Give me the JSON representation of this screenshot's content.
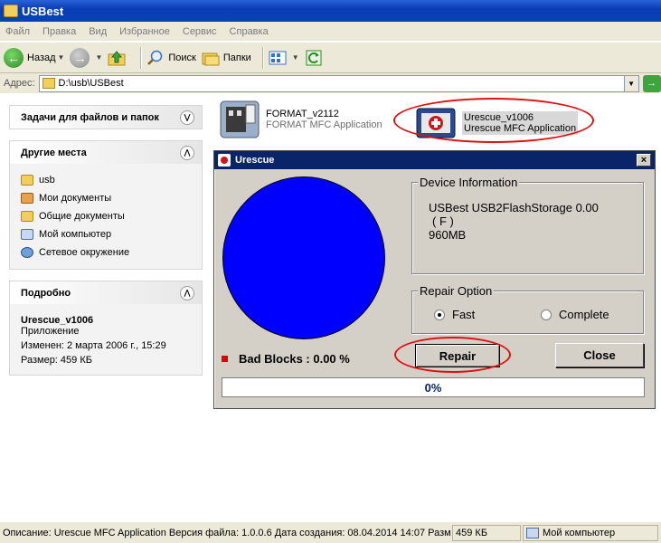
{
  "window": {
    "title": "USBest"
  },
  "menu": [
    "Файл",
    "Правка",
    "Вид",
    "Избранное",
    "Сервис",
    "Справка"
  ],
  "toolbar": {
    "back": "Назад",
    "search": "Поиск",
    "folders": "Папки"
  },
  "address": {
    "label": "Адрес:",
    "value": "D:\\usb\\USBest"
  },
  "left": {
    "tasks_title": "Задачи для файлов и папок",
    "places_title": "Другие места",
    "places": [
      "usb",
      "Мои документы",
      "Общие документы",
      "Мой компьютер",
      "Сетевое окружение"
    ],
    "details_title": "Подробно",
    "details": {
      "name": "Urescue_v1006",
      "type": "Приложение",
      "modified": "Изменен: 2 марта 2006 г., 15:29",
      "size": "Размер: 459 КБ"
    }
  },
  "files": [
    {
      "name": "FORMAT_v2112",
      "desc": "FORMAT MFC Application"
    },
    {
      "name": "Urescue_v1006",
      "desc": "Urescue MFC Application"
    }
  ],
  "dialog": {
    "title": "Urescue",
    "close_x": "×",
    "device_info_title": "Device Information",
    "device_line1": "USBest   USB2FlashStorage 0.00",
    "device_line2": "( F )",
    "device_line3": "960MB",
    "repair_option_title": "Repair Option",
    "option_fast": "Fast",
    "option_complete": "Complete",
    "selected_option": "Fast",
    "bad_blocks": "Bad Blocks : 0.00 %",
    "repair_button": "Repair",
    "close_button": "Close",
    "progress": "0%",
    "disk_color": "#0000ff"
  },
  "status": {
    "description": "Описание: Urescue MFC Application Версия файла: 1.0.0.6 Дата создания: 08.04.2014 14:07 Размер",
    "size": "459 КБ",
    "location": "Мой компьютер"
  }
}
